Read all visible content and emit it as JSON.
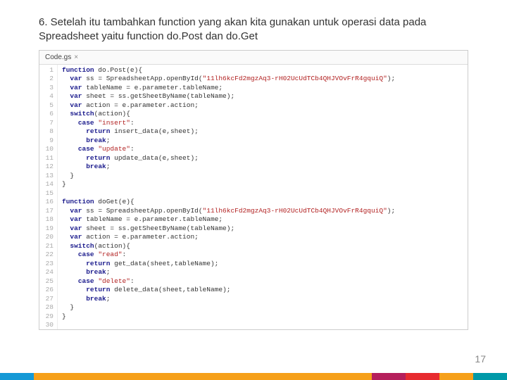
{
  "title": "6. Setelah itu tambahkan function yang akan kita gunakan untuk operasi data pada Spreadsheet yaitu function do.Post dan do.Get",
  "tab": {
    "label": "Code.gs",
    "close": "×"
  },
  "lines": [
    {
      "n": 1,
      "html": "<span class='kw'>function</span> do.Post(e){"
    },
    {
      "n": 2,
      "html": "  <span class='kw'>var</span> ss = SpreadsheetApp.openById(<span class='str'>\"11lh6kcFd2mgzAq3-rH02UcUdTCb4QHJVOvFrR4gquiQ\"</span>);"
    },
    {
      "n": 3,
      "html": "  <span class='kw'>var</span> tableName = e.parameter.tableName;"
    },
    {
      "n": 4,
      "html": "  <span class='kw'>var</span> sheet = ss.getSheetByName(tableName);"
    },
    {
      "n": 5,
      "html": "  <span class='kw'>var</span> action = e.parameter.action;"
    },
    {
      "n": 6,
      "html": "  <span class='kw'>switch</span>(action){"
    },
    {
      "n": 7,
      "html": "    <span class='kw'>case</span> <span class='str'>\"insert\"</span>:"
    },
    {
      "n": 8,
      "html": "      <span class='kw'>return</span> insert_data(e,sheet);"
    },
    {
      "n": 9,
      "html": "      <span class='kw'>break</span>;"
    },
    {
      "n": 10,
      "html": "    <span class='kw'>case</span> <span class='str'>\"update\"</span>:"
    },
    {
      "n": 11,
      "html": "      <span class='kw'>return</span> update_data(e,sheet);"
    },
    {
      "n": 12,
      "html": "      <span class='kw'>break</span>;"
    },
    {
      "n": 13,
      "html": "  }"
    },
    {
      "n": 14,
      "html": "}"
    },
    {
      "n": 15,
      "html": ""
    },
    {
      "n": 16,
      "html": "<span class='kw'>function</span> doGet(e){"
    },
    {
      "n": 17,
      "html": "  <span class='kw'>var</span> ss = SpreadsheetApp.openById(<span class='str'>\"11lh6kcFd2mgzAq3-rH02UcUdTCb4QHJVOvFrR4gquiQ\"</span>);"
    },
    {
      "n": 18,
      "html": "  <span class='kw'>var</span> tableName = e.parameter.tableName;"
    },
    {
      "n": 19,
      "html": "  <span class='kw'>var</span> sheet = ss.getSheetByName(tableName);"
    },
    {
      "n": 20,
      "html": "  <span class='kw'>var</span> action = e.parameter.action;"
    },
    {
      "n": 21,
      "html": "  <span class='kw'>switch</span>(action){"
    },
    {
      "n": 22,
      "html": "    <span class='kw'>case</span> <span class='str'>\"read\"</span>:"
    },
    {
      "n": 23,
      "html": "      <span class='kw'>return</span> get_data(sheet,tableName);"
    },
    {
      "n": 24,
      "html": "      <span class='kw'>break</span>;"
    },
    {
      "n": 25,
      "html": "    <span class='kw'>case</span> <span class='str'>\"delete\"</span>:"
    },
    {
      "n": 26,
      "html": "      <span class='kw'>return</span> delete_data(sheet,tableName);"
    },
    {
      "n": 27,
      "html": "      <span class='kw'>break</span>;"
    },
    {
      "n": 28,
      "html": "  }"
    },
    {
      "n": 29,
      "html": "}"
    },
    {
      "n": 30,
      "html": ""
    }
  ],
  "pageNumber": "17"
}
